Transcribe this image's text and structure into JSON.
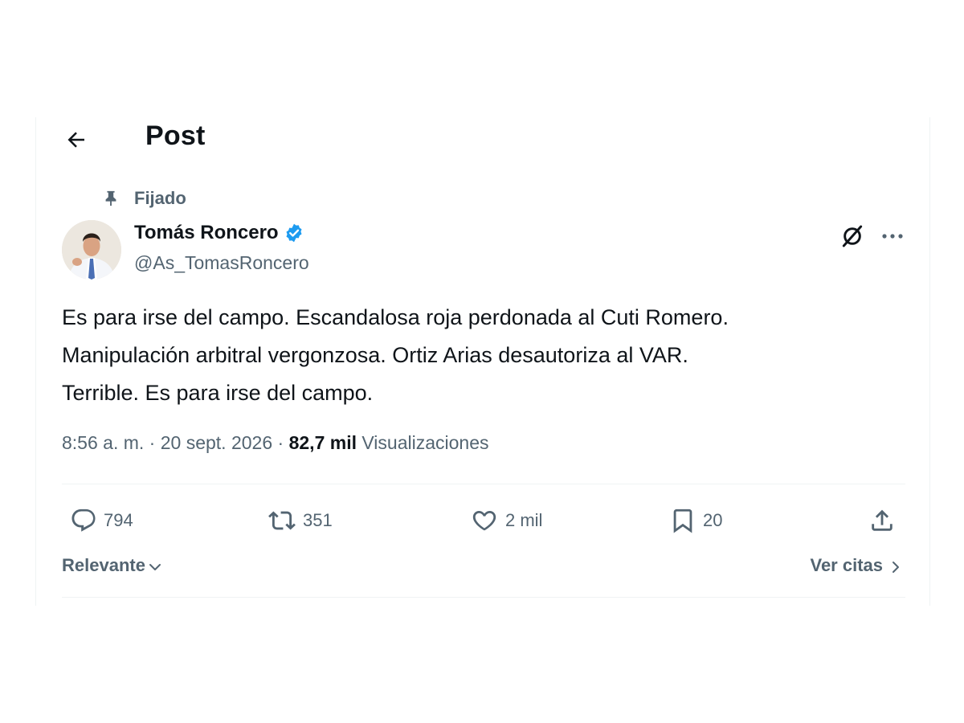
{
  "header": {
    "title": "Post",
    "back_icon": "arrow-left-icon"
  },
  "post": {
    "pinned_label": "Fijado",
    "author": {
      "name": "Tomás Roncero",
      "handle": "@As_TomasRoncero",
      "verified": true
    },
    "text_lines": [
      "Es para irse del campo. Escandalosa roja perdonada al Cuti Romero.",
      "Manipulación arbitral vergonzosa. Ortiz Arias desautoriza al VAR.",
      "Terrible. Es para irse del campo."
    ],
    "meta": {
      "time": "8:56 a. m.",
      "separator": " · ",
      "date": "20 sept. 2026",
      "views_count": "82,7 mil",
      "views_label": "Visualizaciones"
    },
    "actions": {
      "replies": "794",
      "reposts": "351",
      "likes": "2 mil",
      "bookmarks": "20"
    }
  },
  "footer": {
    "sort_label": "Relevante",
    "quotes_label": "Ver citas"
  },
  "colors": {
    "text_primary": "#0f1419",
    "text_secondary": "#536471",
    "verified_blue": "#1d9bf0",
    "divider": "#eff3f4"
  }
}
